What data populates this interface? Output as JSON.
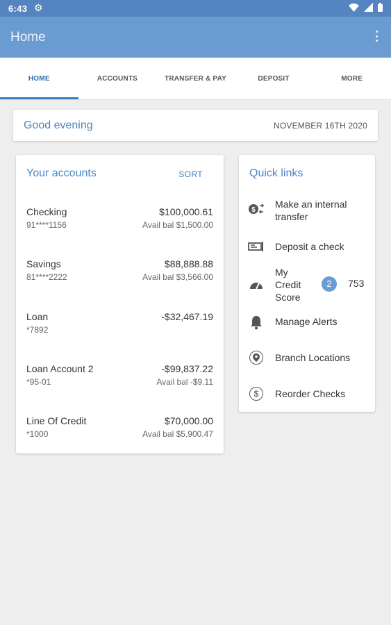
{
  "status_bar": {
    "time": "6:43"
  },
  "app_bar": {
    "title": "Home"
  },
  "tabs": [
    {
      "label": "HOME",
      "active": true
    },
    {
      "label": "ACCOUNTS"
    },
    {
      "label": "TRANSFER & PAY"
    },
    {
      "label": "DEPOSIT"
    },
    {
      "label": "MORE"
    }
  ],
  "greeting": {
    "text": "Good evening",
    "date": "NOVEMBER 16TH 2020"
  },
  "accounts": {
    "title": "Your accounts",
    "sort_label": "SORT",
    "items": [
      {
        "name": "Checking",
        "number": "91****1156",
        "amount": "$100,000.61",
        "avail": "Avail bal $1,500.00"
      },
      {
        "name": "Savings",
        "number": "81****2222",
        "amount": "$88,888.88",
        "avail": "Avail bal $3,566.00"
      },
      {
        "name": "Loan",
        "number": "*7892",
        "amount": "-$32,467.19",
        "avail": ""
      },
      {
        "name": "Loan Account 2",
        "number": "*95-01",
        "amount": "-$99,837.22",
        "avail": "Avail bal -$9.11"
      },
      {
        "name": "Line Of Credit",
        "number": "*1000",
        "amount": "$70,000.00",
        "avail": "Avail bal $5,900.47"
      }
    ]
  },
  "quick_links": {
    "title": "Quick links",
    "items": [
      {
        "label": "Make an internal transfer",
        "icon": "transfer-icon"
      },
      {
        "label": "Deposit a check",
        "icon": "check-deposit-icon"
      },
      {
        "label": "My Credit Score",
        "icon": "gauge-icon",
        "badge": "2",
        "score": "753"
      },
      {
        "label": "Manage Alerts",
        "icon": "bell-icon"
      },
      {
        "label": "Branch Locations",
        "icon": "location-pin-icon"
      },
      {
        "label": "Reorder Checks",
        "icon": "dollar-icon",
        "glyph": "$"
      }
    ]
  },
  "colors": {
    "status_bar": "#5585c0",
    "app_bar": "#6a9bd1",
    "accent": "#4a86c5",
    "background": "#eeeeee"
  }
}
